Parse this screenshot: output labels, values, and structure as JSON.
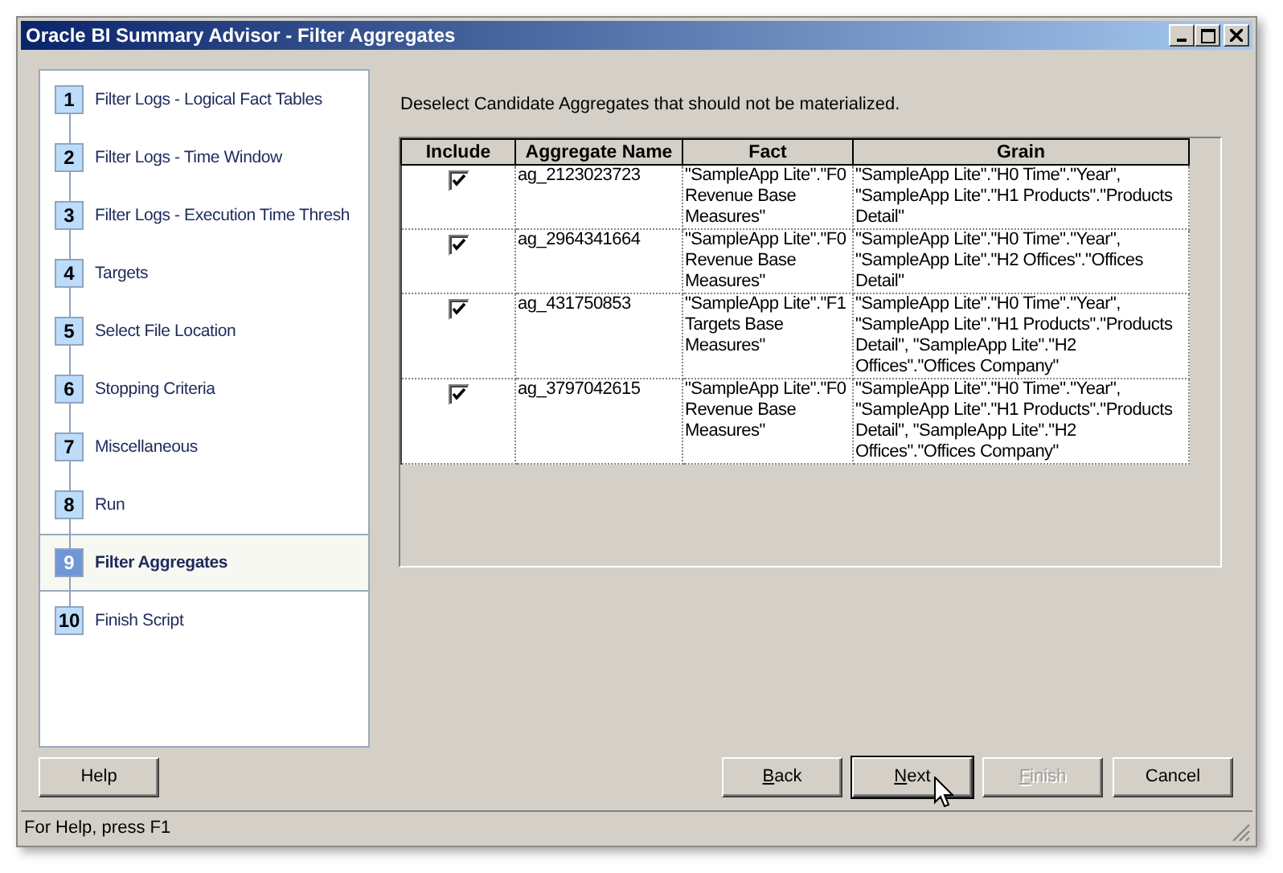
{
  "window": {
    "title": "Oracle BI Summary Advisor - Filter Aggregates"
  },
  "steps": [
    {
      "number": "1",
      "label": "Filter Logs - Logical Fact Tables",
      "selected": false
    },
    {
      "number": "2",
      "label": "Filter Logs - Time Window",
      "selected": false
    },
    {
      "number": "3",
      "label": "Filter Logs - Execution Time Thresh",
      "selected": false
    },
    {
      "number": "4",
      "label": "Targets",
      "selected": false
    },
    {
      "number": "5",
      "label": "Select File Location",
      "selected": false
    },
    {
      "number": "6",
      "label": "Stopping Criteria",
      "selected": false
    },
    {
      "number": "7",
      "label": "Miscellaneous",
      "selected": false
    },
    {
      "number": "8",
      "label": "Run",
      "selected": false
    },
    {
      "number": "9",
      "label": "Filter Aggregates",
      "selected": true
    },
    {
      "number": "10",
      "label": "Finish Script",
      "selected": false
    }
  ],
  "instruction": "Deselect Candidate Aggregates that should not be materialized.",
  "table": {
    "columns": [
      "Include",
      "Aggregate Name",
      "Fact",
      "Grain"
    ],
    "rows": [
      {
        "include": true,
        "name": "ag_2123023723",
        "fact": "\"SampleApp Lite\".\"F0 Revenue Base Measures\"",
        "grain": "\"SampleApp Lite\".\"H0 Time\".\"Year\", \"SampleApp Lite\".\"H1 Products\".\"Products Detail\""
      },
      {
        "include": true,
        "name": "ag_2964341664",
        "fact": "\"SampleApp Lite\".\"F0 Revenue Base Measures\"",
        "grain": "\"SampleApp Lite\".\"H0 Time\".\"Year\", \"SampleApp Lite\".\"H2 Offices\".\"Offices Detail\""
      },
      {
        "include": true,
        "name": "ag_431750853",
        "fact": "\"SampleApp Lite\".\"F1 Targets Base Measures\"",
        "grain": "\"SampleApp Lite\".\"H0 Time\".\"Year\", \"SampleApp Lite\".\"H1 Products\".\"Products Detail\", \"SampleApp Lite\".\"H2 Offices\".\"Offices Company\""
      },
      {
        "include": true,
        "name": "ag_3797042615",
        "fact": "\"SampleApp Lite\".\"F0 Revenue Base Measures\"",
        "grain": "\"SampleApp Lite\".\"H0 Time\".\"Year\", \"SampleApp Lite\".\"H1 Products\".\"Products Detail\", \"SampleApp Lite\".\"H2 Offices\".\"Offices Company\""
      }
    ]
  },
  "help_button": {
    "label": "Help"
  },
  "nav_buttons": [
    {
      "label": "Back",
      "mnemonic": true,
      "disabled": false,
      "focused": false
    },
    {
      "label": "Next",
      "mnemonic": true,
      "disabled": false,
      "focused": true
    },
    {
      "label": "Finish",
      "mnemonic": true,
      "disabled": true,
      "focused": false
    },
    {
      "label": "Cancel",
      "mnemonic": false,
      "disabled": false,
      "focused": false
    }
  ],
  "status_bar": {
    "text": "For Help, press F1"
  }
}
